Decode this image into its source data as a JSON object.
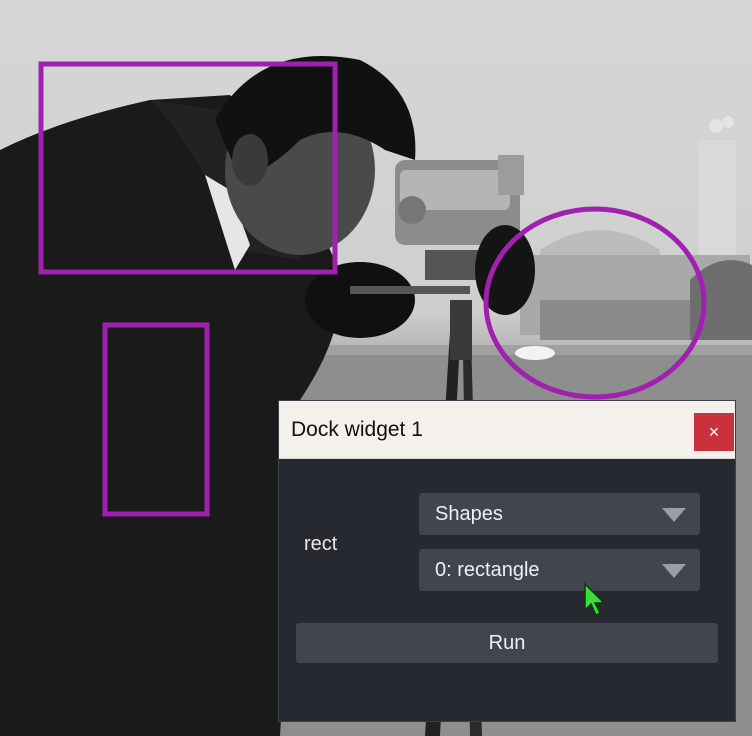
{
  "background": {
    "description_icon": "cameraman-photo"
  },
  "shapes": {
    "color": "#a021b0",
    "items": [
      {
        "type": "rectangle"
      },
      {
        "type": "rectangle"
      },
      {
        "type": "ellipse"
      }
    ]
  },
  "dock": {
    "title": "Dock widget 1",
    "close_label": "×",
    "layer_label": "rect",
    "layer_type_select": {
      "selected": "Shapes"
    },
    "shape_select": {
      "selected": "0: rectangle"
    },
    "run_label": "Run",
    "colors": {
      "close_bg": "#c9313d",
      "panel_bg": "#262930",
      "control_bg": "#414550",
      "cursor": "#3ddc3d"
    }
  }
}
